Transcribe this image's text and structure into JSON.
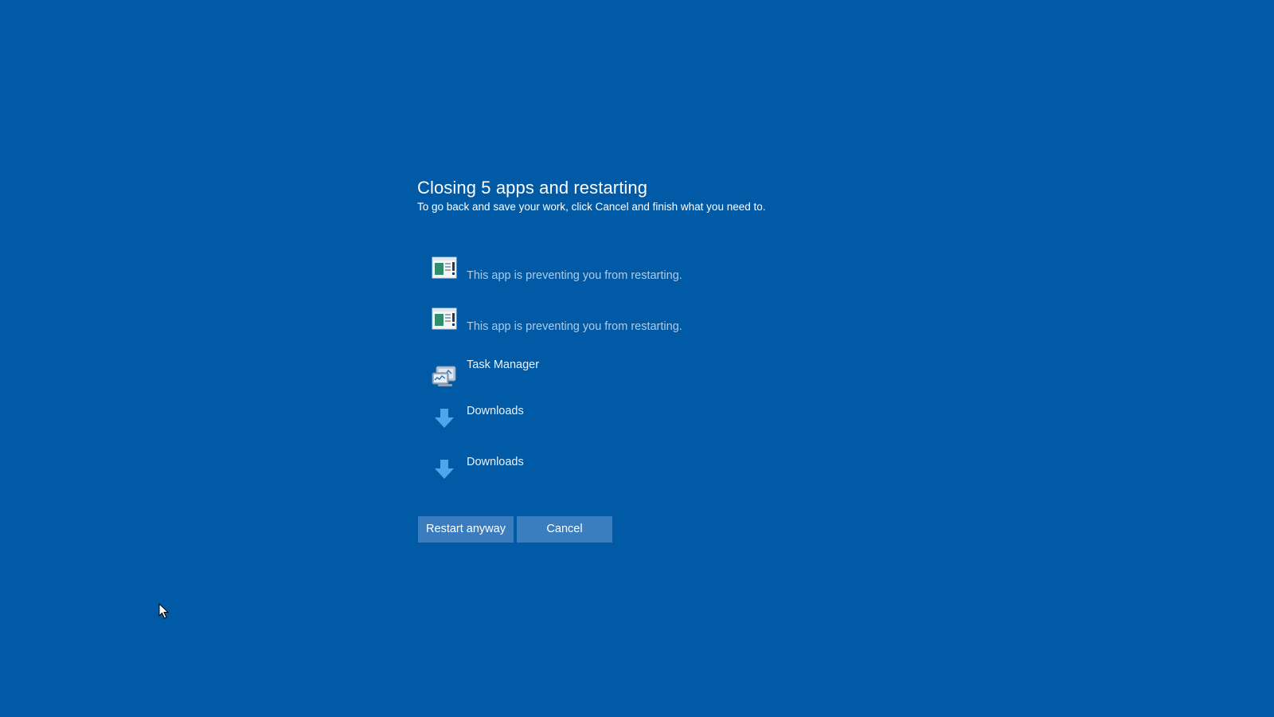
{
  "dialog": {
    "title": "Closing 5 apps and restarting",
    "subtitle": "To go back and save your work, click Cancel and finish what you need to."
  },
  "apps": [
    {
      "label": "This app is preventing you from restarting.",
      "icon": "blocking-app-icon"
    },
    {
      "label": "This app is preventing you from restarting.",
      "icon": "blocking-app-icon"
    },
    {
      "label": "Task Manager",
      "icon": "task-manager-icon"
    },
    {
      "label": "Downloads",
      "icon": "download-arrow-icon"
    },
    {
      "label": "Downloads",
      "icon": "download-arrow-icon"
    }
  ],
  "buttons": {
    "restart_label": "Restart anyway",
    "cancel_label": "Cancel"
  },
  "colors": {
    "background": "#005aa6",
    "button": "#3a7cbd",
    "muted_text": "#aecbea",
    "arrow": "#4ea6ea"
  }
}
